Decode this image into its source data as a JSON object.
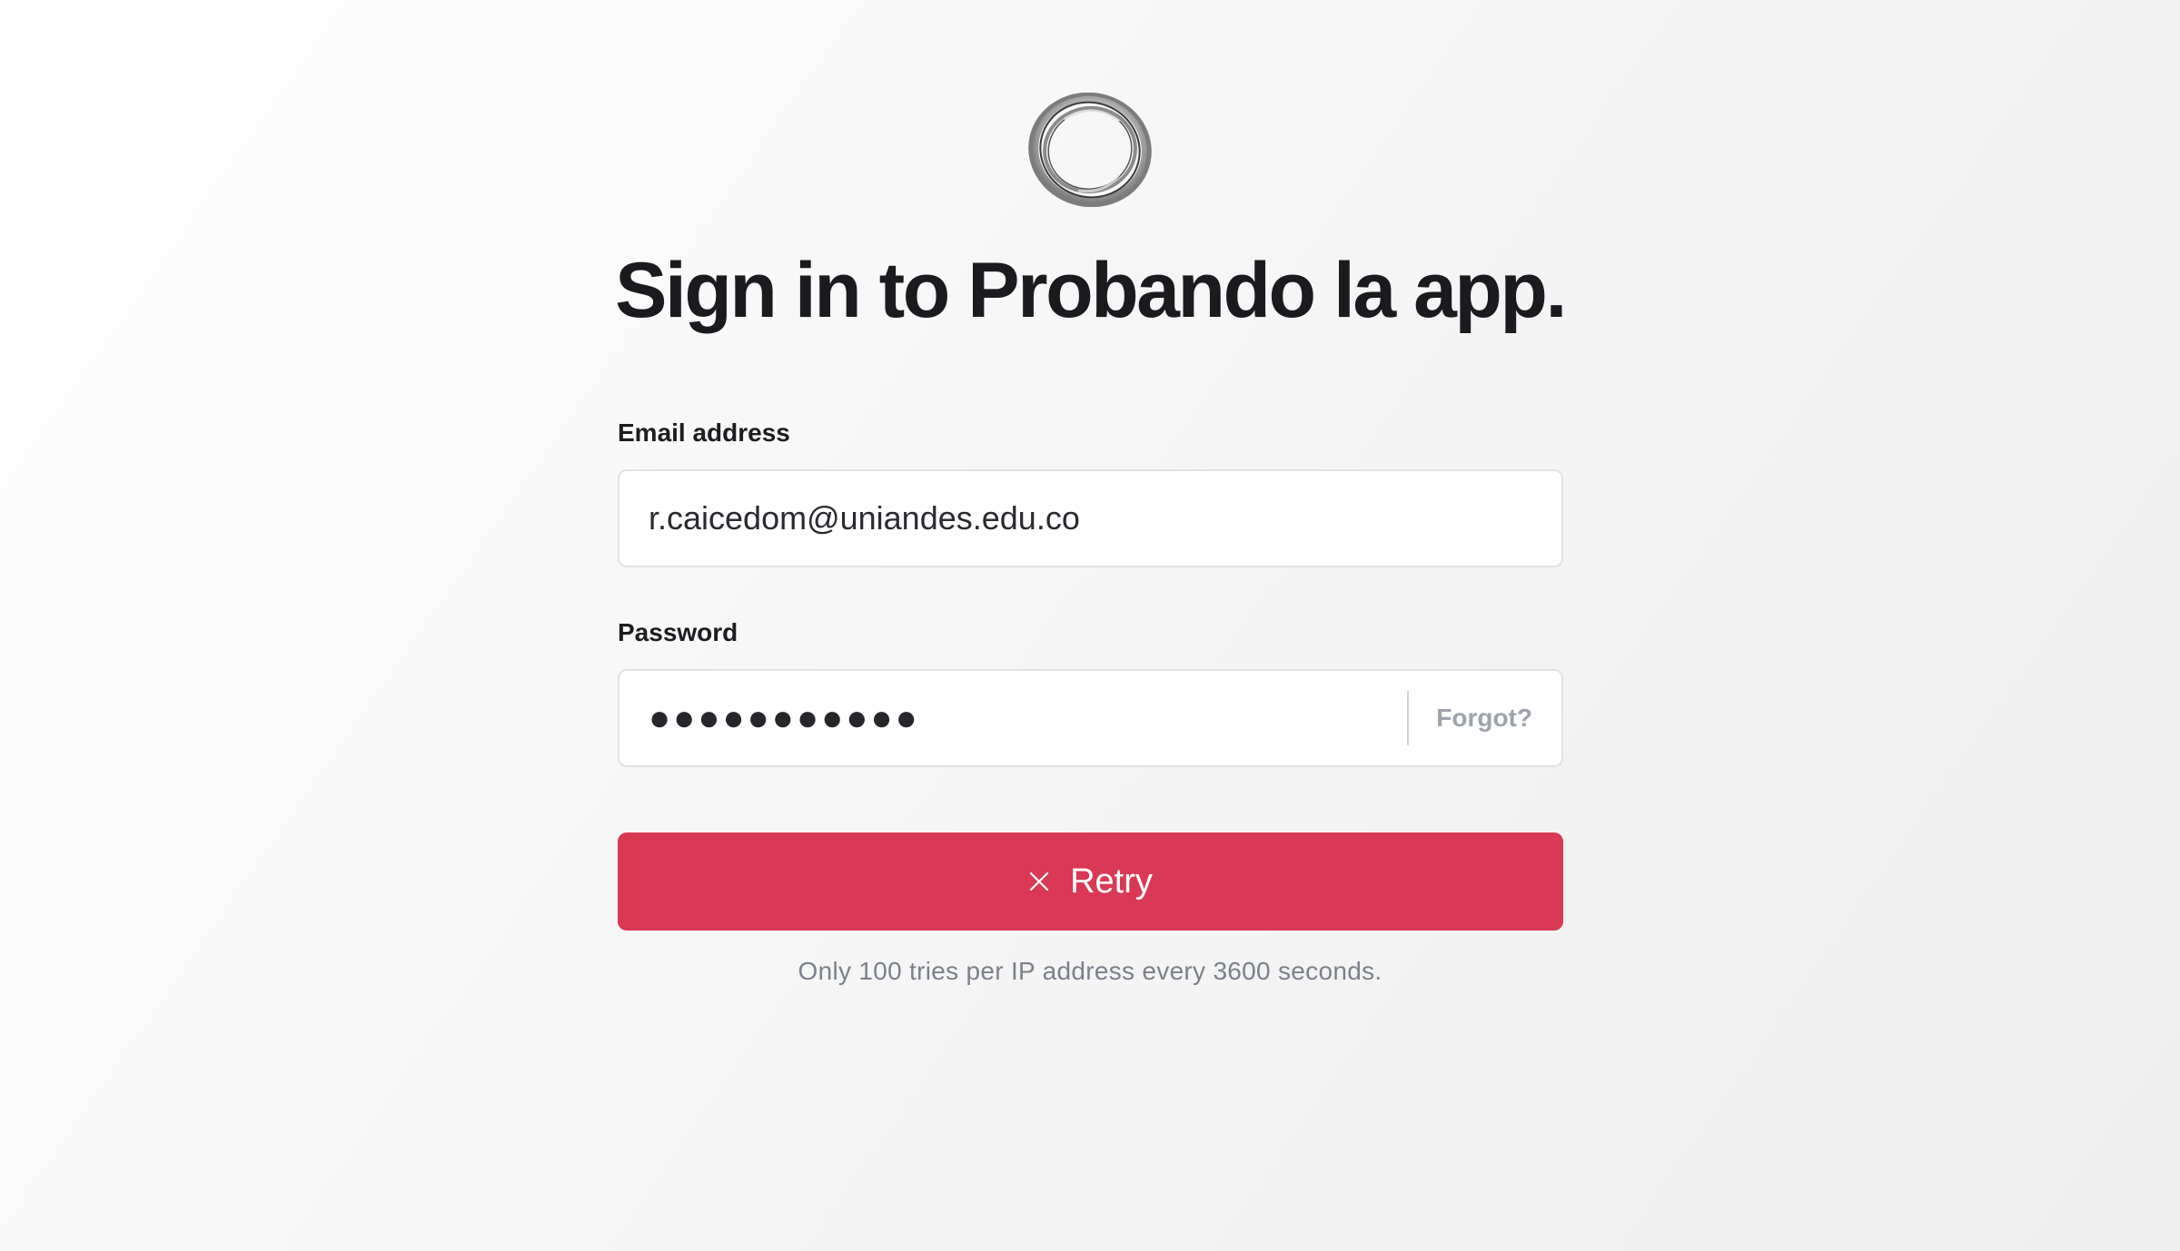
{
  "logo": {
    "icon": "ring-logo-icon"
  },
  "title": "Sign in to Probando la app.",
  "email": {
    "label": "Email address",
    "value": "r.caicedom@uniandes.edu.co"
  },
  "password": {
    "label": "Password",
    "masked_value": "●●●●●●●●●●●",
    "forgot_label": "Forgot?"
  },
  "retry_button": {
    "label": "Retry",
    "icon": "close-icon"
  },
  "rate_limit_note": "Only 100 tries per IP address every 3600 seconds.",
  "colors": {
    "accent": "#d93955",
    "text": "#1b1b1f",
    "muted": "#7b818a",
    "border": "#e1e2e5"
  }
}
